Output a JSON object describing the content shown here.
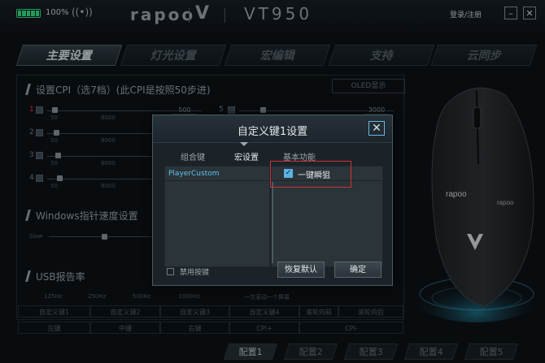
{
  "titlebar": {
    "battery_pct": "100%",
    "brand": "rapoo",
    "brand_v": "V",
    "model": "VT950",
    "login": "登录/注册",
    "minimize": "–",
    "close": "✕",
    "wireless_glyph": "((•))"
  },
  "tabs": [
    "主要设置",
    "灯光设置",
    "宏编辑",
    "支持",
    "云同步"
  ],
  "active_tab": 0,
  "bg": {
    "dpi_title": "设置CPI（选7档）(此CPI是按照50步进)",
    "oled": "OLED显示",
    "dpi_rows_left": [
      {
        "num": "1",
        "min": "50",
        "mid": "8000",
        "max": "16000",
        "value": "500"
      },
      {
        "num": "2",
        "min": "50",
        "mid": "8000",
        "max": "16000",
        "value": ""
      },
      {
        "num": "3",
        "min": "50",
        "mid": "8000",
        "max": "16000",
        "value": ""
      },
      {
        "num": "4",
        "min": "50",
        "mid": "8000",
        "max": "16000",
        "value": ""
      }
    ],
    "dpi_rows_right": [
      {
        "num": "5",
        "value": "3000"
      }
    ],
    "pointer_title": "Windows指针速度设置",
    "pointer_slow": "Slow",
    "usb_title": "USB报告率",
    "usb_rates": [
      "125Hz",
      "250Hz",
      "500Hz",
      "1000Hz"
    ],
    "usb_extra": "一次滚动一个屏幕",
    "grid_row1": [
      "自定义键1",
      "自定义键2",
      "自定义键3",
      "自定义键4",
      "滚轮向前",
      "滚轮向后"
    ],
    "grid_row2": [
      "左键",
      "中键",
      "右键",
      "CPI+",
      "CPI-",
      ""
    ]
  },
  "configs": [
    "配置1",
    "配置2",
    "配置3",
    "配置4",
    "配置5"
  ],
  "dialog": {
    "title": "自定义键1设置",
    "close": "✕",
    "subtabs": [
      "组合键",
      "宏设置",
      "基本功能"
    ],
    "active_subtab": 1,
    "macro_item": "PlayerCustom",
    "checkbox_label": "一键瞬狙",
    "checkbox_checked": true,
    "disable_label": "禁用按键",
    "restore": "恢复默认",
    "ok": "确定"
  },
  "colors": {
    "accent": "#5ab3e3",
    "highlight_frame": "#cc3333",
    "battery": "#2fd07a"
  }
}
